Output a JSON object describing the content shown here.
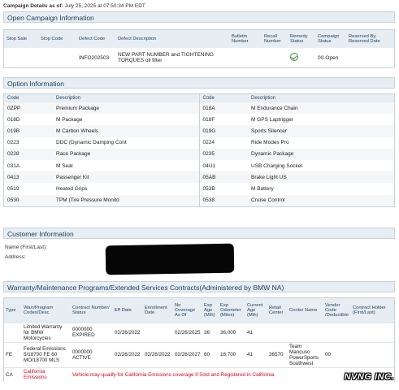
{
  "header": {
    "label": "Campaign Details as of:",
    "date": "July 25, 2025 at 07:50:34 PM EDT"
  },
  "campaign": {
    "title": "Open Campaign Information",
    "columns": [
      "Stop Sale",
      "Stop Code",
      "Defect Code",
      "Defect Description",
      "Bulletin Number",
      "Recall Number",
      "Remedy Status",
      "Campaign Status",
      "Reserved By, Reserved Date"
    ],
    "row": {
      "stop_sale": "",
      "stop_code": "",
      "defect_code": "INFO202503",
      "defect_description": "NEW PART NUMBER and TIGHTENING TORQUES oil filter",
      "bulletin_number": "",
      "recall_number": "",
      "remedy_status_icon": "check-circle-icon",
      "campaign_status": "00-Open",
      "reserved": ""
    }
  },
  "options": {
    "title": "Option Information",
    "col_code": "Code",
    "col_desc": "Description",
    "left": [
      {
        "code": "0ZPP",
        "desc": "Premium Package"
      },
      {
        "code": "018D",
        "desc": "M Package"
      },
      {
        "code": "019B",
        "desc": "M Carbon Wheels"
      },
      {
        "code": "0223",
        "desc": "DDC (Dynamic Damping Cont"
      },
      {
        "code": "0228",
        "desc": "Race Package"
      },
      {
        "code": "031A",
        "desc": "M Seat"
      },
      {
        "code": "0413",
        "desc": "Passenger Kit"
      },
      {
        "code": "0519",
        "desc": "Heated Grips"
      },
      {
        "code": "0530",
        "desc": "TPM (Tire Pressure Monito"
      }
    ],
    "right": [
      {
        "code": "018A",
        "desc": "M Endurance Chain"
      },
      {
        "code": "018F",
        "desc": "M GPS Laptrigger"
      },
      {
        "code": "019G",
        "desc": "Sports Silencer"
      },
      {
        "code": "0224",
        "desc": "Ride Modes Pro"
      },
      {
        "code": "0235",
        "desc": "Dynamic Package"
      },
      {
        "code": "04U1",
        "desc": "USB Charging Socket"
      },
      {
        "code": "05AB",
        "desc": "Brake Light US"
      },
      {
        "code": "053B",
        "desc": "M Battery"
      },
      {
        "code": "0538",
        "desc": "Cruise Control"
      }
    ]
  },
  "customer": {
    "title": "Customer Information",
    "name_label": "Name (First/Last):",
    "address_label": "Address:"
  },
  "warranty": {
    "title": "Warranty/Maintenance Programs/Extended Services Contracts(Administered by BMW NA)",
    "columns": [
      "Type",
      "Warr/Program Codes/Desc",
      "Contract Number/ Status",
      "Eff Date",
      "Enrollment Date",
      "No Coverage As Of",
      "Exp Age (Mth)",
      "Exp Odometer (Miles)",
      "Current Age (Mth)",
      "Retail Center",
      "Center Name",
      "Vendor Code /Deductible",
      "Contract Holder (First/Last)"
    ],
    "rows": [
      {
        "type": "",
        "program": "Limited Warranty for BMW Motorcycles",
        "contract": "0000000 EXPIRED",
        "eff": "02/26/2022",
        "enroll": "",
        "nocov": "02/26/2025",
        "expage": "36",
        "expodo": "36,000",
        "curage": "41",
        "retail": "",
        "center": "",
        "vendor": "",
        "holder": ""
      },
      {
        "type": "FE",
        "program": "Federal Emissions 5/18700 FE 60 MO/18700 MLS",
        "contract": "0000000 ACTIVE",
        "eff": "02/26/2022",
        "enroll": "02/26/2022",
        "nocov": "02/26/2027",
        "expage": "60",
        "expodo": "18,700",
        "curage": "41",
        "retail": "36570",
        "center": "Team Mancuso PowerSports Southwest",
        "vendor": "00",
        "holder": ""
      },
      {
        "type": "CA",
        "program": "California Emissions",
        "note": "Vehicle may qualify for California Emissions coverage if Sold and Registered in California."
      }
    ]
  },
  "watermark": "NVNG INC.",
  "colors": {
    "section_bg": "#e6edf3",
    "section_text": "#1f3d5a",
    "alert": "#d0021b",
    "ok": "#3a8a3a"
  }
}
